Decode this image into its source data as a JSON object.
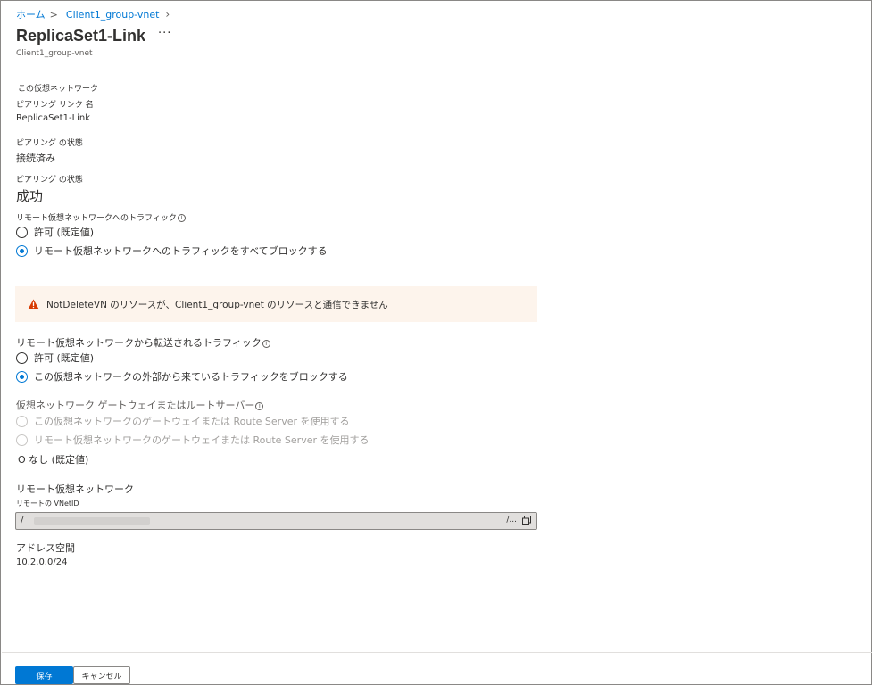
{
  "breadcrumb": {
    "home": "ホーム",
    "separator": ">",
    "current": "Client1_group-vnet",
    "chevron": "›"
  },
  "header": {
    "title": "ReplicaSet1-Link",
    "more": "···",
    "subtitle": "Client1_group-vnet"
  },
  "local_vnet": {
    "section_label": "この仮想ネットワーク",
    "link_name_label": "ピアリング リンク 名",
    "link_name_value": "ReplicaSet1-Link",
    "peering_status_label": "ピアリング の状態",
    "peering_status_value": "接続済み",
    "peering_state_label": "ピアリング の状態",
    "peering_state_value": "成功"
  },
  "traffic_to_remote": {
    "label": "リモート仮想ネットワークへのトラフィック",
    "info_icon": "info-icon",
    "options": [
      {
        "label": "許可 (既定値)",
        "checked": false
      },
      {
        "label": "リモート仮想ネットワークへのトラフィックをすべてブロックする",
        "checked": true
      }
    ]
  },
  "warning": {
    "icon": "warning-icon",
    "text": "NotDeleteVN のリソースが、Client1_group-vnet のリソースと通信できません",
    "color": "#d83b01"
  },
  "forwarded_traffic": {
    "label": "リモート仮想ネットワークから転送されるトラフィック",
    "info_icon": "info-icon",
    "options": [
      {
        "label": "許可 (既定値)",
        "checked": false
      },
      {
        "label": "この仮想ネットワークの外部から来ているトラフィックをブロックする",
        "checked": true
      }
    ]
  },
  "gateway": {
    "label": "仮想ネットワーク ゲートウェイまたはルートサーバー",
    "info_icon": "info-icon",
    "options": [
      {
        "label": "この仮想ネットワークのゲートウェイまたは Route Server を使用する",
        "disabled": true
      },
      {
        "label": "リモート仮想ネットワークのゲートウェイまたは Route Server を使用する",
        "disabled": true
      }
    ],
    "none_option": "O なし (既定値)"
  },
  "remote_vnet": {
    "section_label": "リモート仮想ネットワーク",
    "vnet_id_label": "リモートの VNetID",
    "vnet_id_value": "/",
    "edit_label": "/...",
    "address_space_label": "アドレス空間",
    "address_space_value": "10.2.0.0/24"
  },
  "footer": {
    "save_label": "保存",
    "cancel_label": "キャンセル"
  },
  "colors": {
    "accent": "#0078d4",
    "warning_bg": "#fdf4ec"
  }
}
